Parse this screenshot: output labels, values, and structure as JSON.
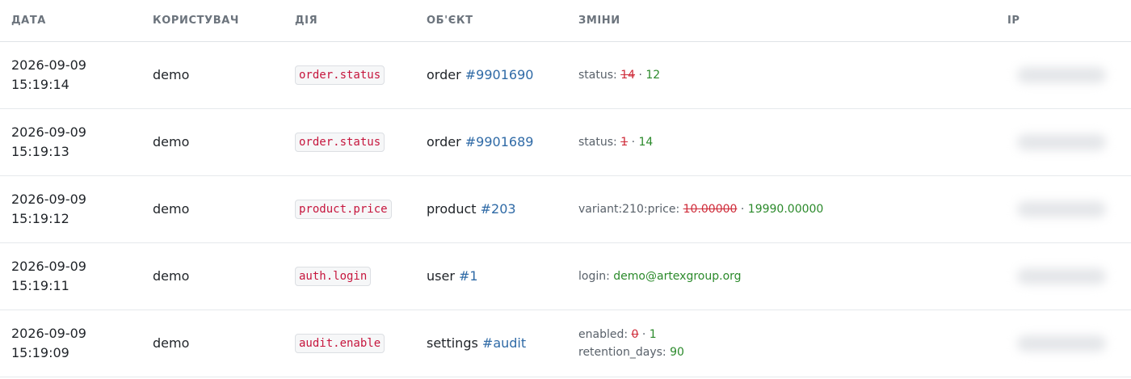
{
  "columns": {
    "date": "ДАТА",
    "user": "КОРИСТУВАЧ",
    "action": "ДІЯ",
    "object": "ОБ'ЄКТ",
    "changes": "ЗМІНИ",
    "ip": "IP"
  },
  "rows": [
    {
      "date": "2026-09-09",
      "time": "15:19:14",
      "user": "demo",
      "action": "order.status",
      "object_type": "order",
      "object_ref": "#9901690",
      "changes": [
        {
          "field": "status:",
          "old": "14",
          "sep": "·",
          "new": "12"
        }
      ]
    },
    {
      "date": "2026-09-09",
      "time": "15:19:13",
      "user": "demo",
      "action": "order.status",
      "object_type": "order",
      "object_ref": "#9901689",
      "changes": [
        {
          "field": "status:",
          "old": "1",
          "sep": "·",
          "new": "14"
        }
      ]
    },
    {
      "date": "2026-09-09",
      "time": "15:19:12",
      "user": "demo",
      "action": "product.price",
      "object_type": "product",
      "object_ref": "#203",
      "changes": [
        {
          "field": "variant:210:price:",
          "old": "10.00000",
          "sep": "·",
          "new": "19990.00000"
        }
      ]
    },
    {
      "date": "2026-09-09",
      "time": "15:19:11",
      "user": "demo",
      "action": "auth.login",
      "object_type": "user",
      "object_ref": "#1",
      "changes": [
        {
          "field": "login:",
          "value": "demo@artexgroup.org"
        }
      ]
    },
    {
      "date": "2026-09-09",
      "time": "15:19:09",
      "user": "demo",
      "action": "audit.enable",
      "object_type": "settings",
      "object_ref": "#audit",
      "changes": [
        {
          "field": "enabled:",
          "old": "0",
          "sep": "·",
          "new": "1"
        },
        {
          "field": "retention_days:",
          "value": "90"
        }
      ]
    }
  ],
  "colors": {
    "action_text": "#c6173e",
    "link": "#2f6aa6",
    "old_value": "#cf2c3a",
    "new_value": "#2b8a2b",
    "header_text": "#6b737c"
  }
}
